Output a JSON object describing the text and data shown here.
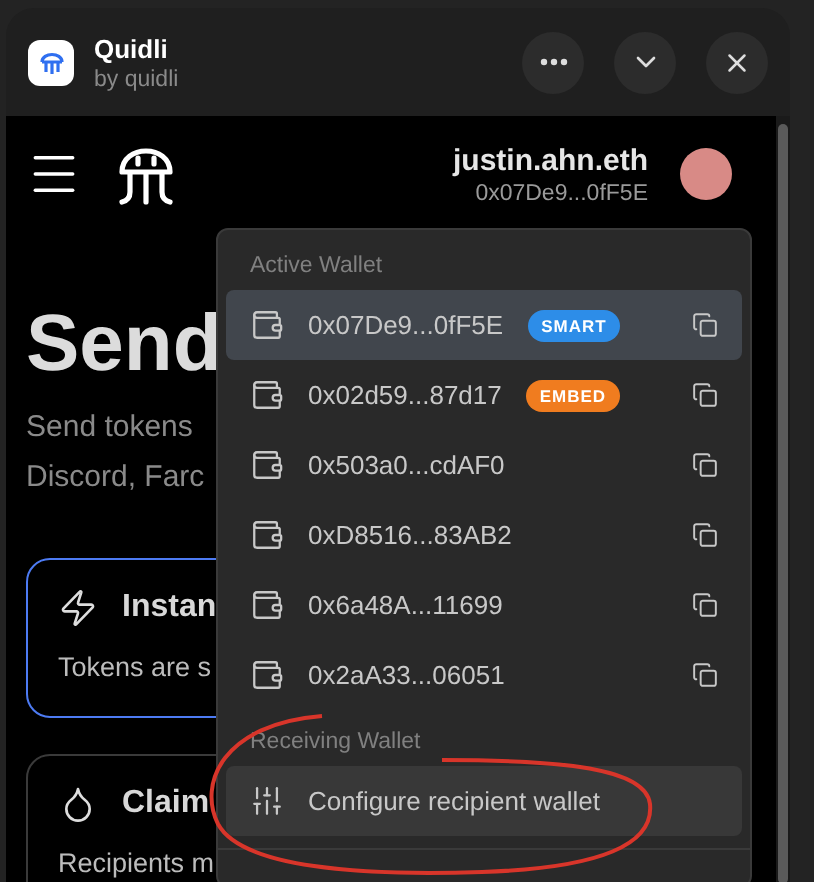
{
  "window": {
    "title": "Quidli",
    "subtitle": "by quidli"
  },
  "account": {
    "name": "justin.ahn.eth",
    "address": "0x07De9...0fF5E"
  },
  "page": {
    "heading": "Send",
    "description_lines": [
      "Send tokens",
      "Discord, Farc"
    ],
    "cards": [
      {
        "title": "Instan",
        "text": "Tokens are s",
        "selected": true,
        "kind": "bolt"
      },
      {
        "title": "Claim",
        "text": "Recipients m",
        "selected": false,
        "kind": "drop"
      }
    ]
  },
  "wallet_menu": {
    "active_label": "Active Wallet",
    "wallets": [
      {
        "address": "0x07De9...0fF5E",
        "selected": true,
        "badge": {
          "label": "SMART",
          "color": "#2d8de8"
        }
      },
      {
        "address": "0x02d59...87d17",
        "selected": false,
        "badge": {
          "label": "EMBED",
          "color": "#f07c1f"
        }
      },
      {
        "address": "0x503a0...cdAF0",
        "selected": false
      },
      {
        "address": "0xD8516...83AB2",
        "selected": false
      },
      {
        "address": "0x6a48A...11699",
        "selected": false
      },
      {
        "address": "0x2aA33...06051",
        "selected": false
      }
    ],
    "receiving_label": "Receiving Wallet",
    "configure": {
      "label": "Configure recipient wallet",
      "selected": true
    }
  }
}
